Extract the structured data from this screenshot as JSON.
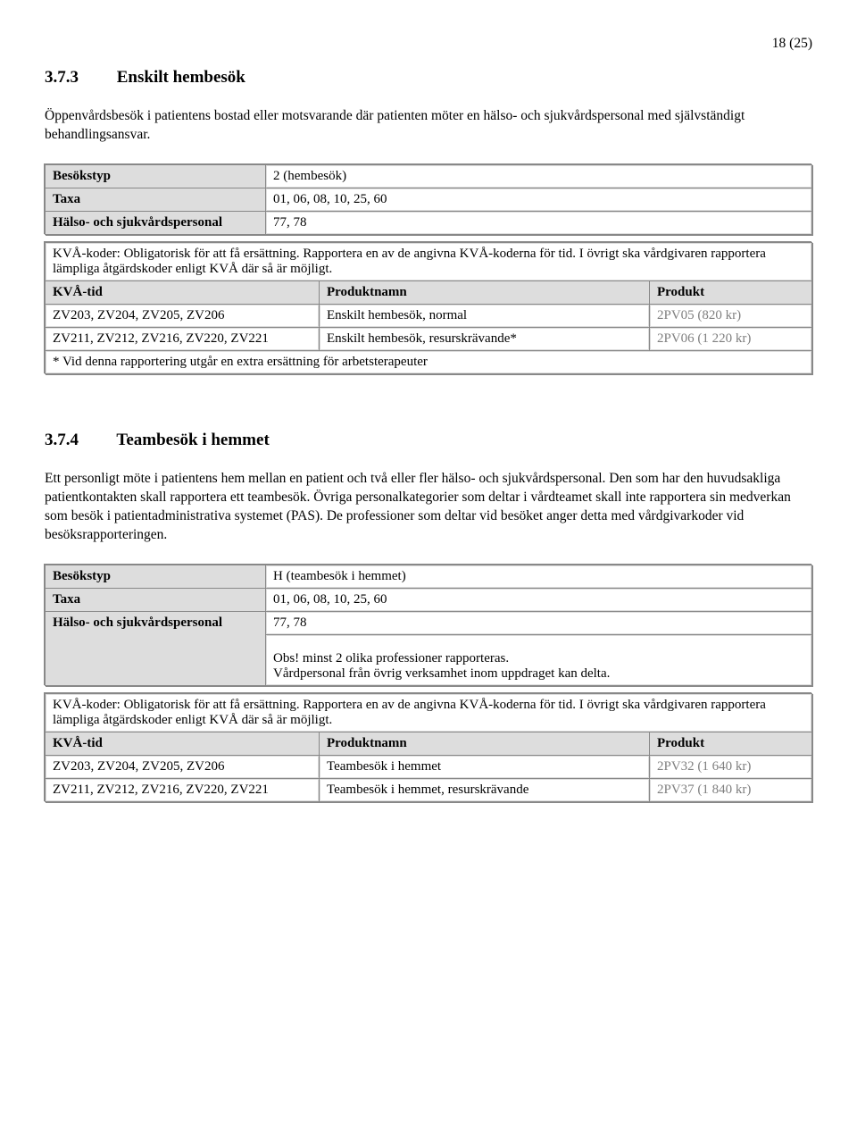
{
  "page_indicator": "18 (25)",
  "sec373": {
    "number": "3.7.3",
    "title": "Enskilt hembesök",
    "intro": "Öppenvårdsbesök i patientens bostad eller motsvarande där patienten möter en hälso- och sjukvårdspersonal med självständigt behandlingsansvar.",
    "rows": {
      "besokstyp_label": "Besökstyp",
      "besokstyp_value": "2 (hembesök)",
      "taxa_label": "Taxa",
      "taxa_value": "01, 06, 08, 10, 25, 60",
      "personal_label": "Hälso- och sjukvårdspersonal",
      "personal_value": "77, 78"
    },
    "kva_text": "KVÅ-koder: Obligatorisk för att få ersättning. Rapportera en av de angivna KVÅ-koderna för tid. I övrigt ska vårdgivaren rapportera lämpliga åtgärdskoder enligt KVÅ där så är möjligt.",
    "data_head": {
      "tid": "KVÅ-tid",
      "name": "Produktnamn",
      "prod": "Produkt"
    },
    "data": [
      {
        "tid": "ZV203, ZV204, ZV205, ZV206",
        "name": "Enskilt hembesök, normal",
        "prod": "2PV05 (820 kr)"
      },
      {
        "tid": "ZV211, ZV212, ZV216, ZV220, ZV221",
        "name": "Enskilt hembesök, resurskrävande*",
        "prod": "2PV06 (1 220 kr)"
      }
    ],
    "footnote": "* Vid denna rapportering utgår en extra ersättning för arbetsterapeuter"
  },
  "sec374": {
    "number": "3.7.4",
    "title": "Teambesök i hemmet",
    "intro": "Ett personligt möte i patientens hem mellan en patient och två eller fler hälso- och sjukvårdspersonal. Den som har den huvudsakliga patientkontakten skall rapportera ett teambesök. Övriga personalkategorier som deltar i vårdteamet skall inte rapportera sin medverkan som besök i patientadministrativa systemet (PAS). De professioner som deltar vid besöket anger detta med vårdgivarkoder vid besöksrapporteringen.",
    "rows": {
      "besokstyp_label": "Besökstyp",
      "besokstyp_value": "H (teambesök i hemmet)",
      "taxa_label": "Taxa",
      "taxa_value": "01, 06, 08, 10, 25, 60",
      "personal_label": "Hälso- och sjukvårdspersonal",
      "personal_value": "77, 78",
      "obs_line1": "Obs! minst 2 olika professioner rapporteras.",
      "obs_line2": "Vårdpersonal från övrig verksamhet inom uppdraget kan delta."
    },
    "kva_text": "KVÅ-koder: Obligatorisk för att få ersättning. Rapportera en av de angivna KVÅ-koderna för tid. I övrigt ska vårdgivaren rapportera lämpliga åtgärdskoder enligt KVÅ där så är möjligt.",
    "data_head": {
      "tid": "KVÅ-tid",
      "name": "Produktnamn",
      "prod": "Produkt"
    },
    "data": [
      {
        "tid": "ZV203, ZV204, ZV205, ZV206",
        "name": "Teambesök i hemmet",
        "prod": "2PV32 (1 640 kr)"
      },
      {
        "tid": "ZV211, ZV212, ZV216, ZV220, ZV221",
        "name": "Teambesök i hemmet, resurskrävande",
        "prod": "2PV37 (1 840 kr)"
      }
    ]
  }
}
